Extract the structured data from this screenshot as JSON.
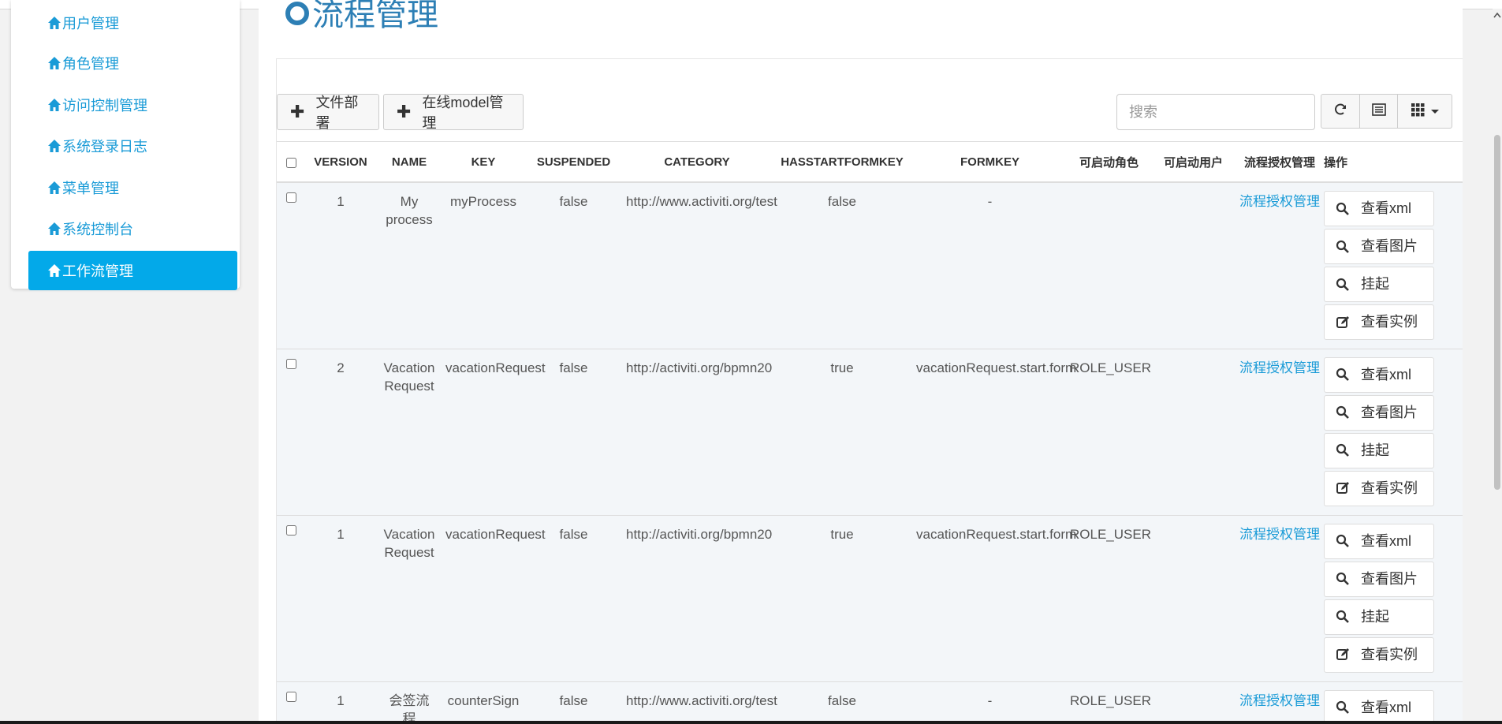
{
  "sidebar": {
    "items": [
      {
        "label": "用户管理"
      },
      {
        "label": "角色管理"
      },
      {
        "label": "访问控制管理"
      },
      {
        "label": "系统登录日志"
      },
      {
        "label": "菜单管理"
      },
      {
        "label": "系统控制台"
      },
      {
        "label": "工作流管理",
        "active": true
      }
    ]
  },
  "page": {
    "title": "流程管理"
  },
  "toolbar": {
    "deploy_label": "文件部署",
    "model_label": "在线model管理",
    "search_placeholder": "搜索"
  },
  "table": {
    "headers": {
      "version": "VERSION",
      "name": "NAME",
      "key": "KEY",
      "suspended": "SUSPENDED",
      "category": "CATEGORY",
      "hasstartformkey": "HASSTARTFORMKEY",
      "formkey": "FORMKEY",
      "roles": "可启动角色",
      "users": "可启动用户",
      "auth": "流程授权管理",
      "ops": "操作"
    },
    "rows": [
      {
        "version": "1",
        "name": "My process",
        "key": "myProcess",
        "suspended": "false",
        "category": "http://www.activiti.org/test",
        "hasstartformkey": "false",
        "formkey": "-",
        "roles": "",
        "users": "",
        "auth": "流程授权管理"
      },
      {
        "version": "2",
        "name": "Vacation Request",
        "key": "vacationRequest",
        "suspended": "false",
        "category": "http://activiti.org/bpmn20",
        "hasstartformkey": "true",
        "formkey": "vacationRequest.start.form",
        "roles": "ROLE_USER",
        "users": "",
        "auth": "流程授权管理"
      },
      {
        "version": "1",
        "name": "Vacation Request",
        "key": "vacationRequest",
        "suspended": "false",
        "category": "http://activiti.org/bpmn20",
        "hasstartformkey": "true",
        "formkey": "vacationRequest.start.form",
        "roles": "ROLE_USER",
        "users": "",
        "auth": "流程授权管理"
      },
      {
        "version": "1",
        "name": "会签流程",
        "key": "counterSign",
        "suspended": "false",
        "category": "http://www.activiti.org/test",
        "hasstartformkey": "false",
        "formkey": "-",
        "roles": "ROLE_USER",
        "users": "",
        "auth": "流程授权管理"
      }
    ],
    "ops": {
      "view_xml": "查看xml",
      "view_diagram": "查看图片",
      "suspend": "挂起",
      "view_instance": "查看实例"
    }
  },
  "colors": {
    "accent": "#03a9e9",
    "link": "#1a9bd7",
    "title": "#2d7fb5",
    "row_bg": "#f3f6f9"
  }
}
